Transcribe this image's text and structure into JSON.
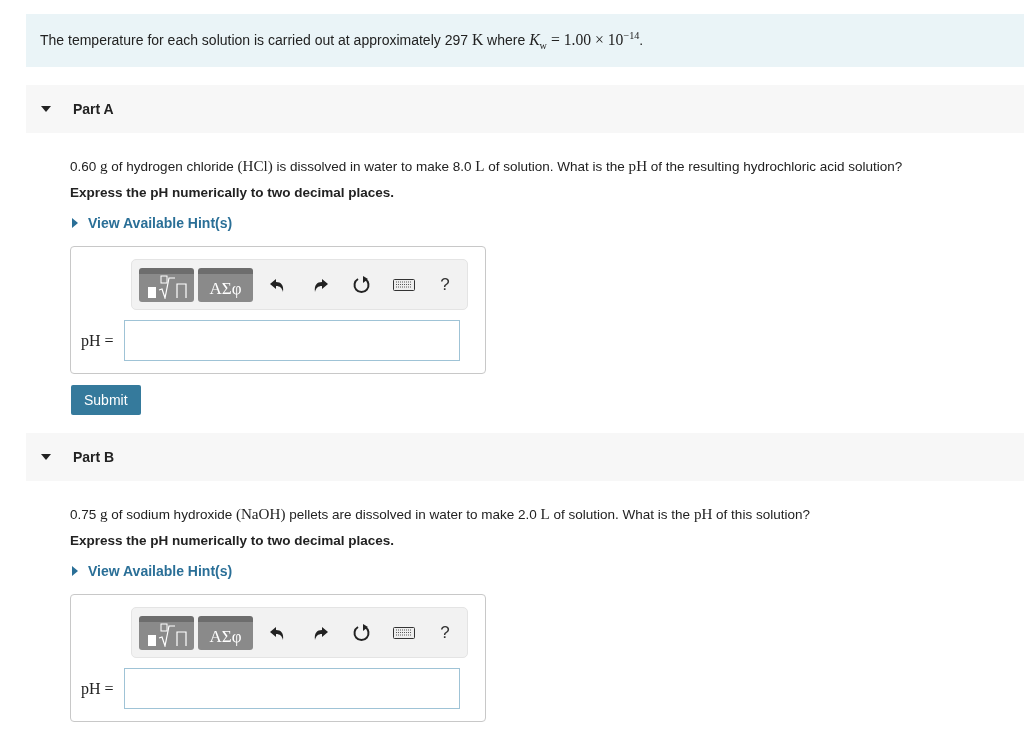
{
  "intro": [
    {
      "kind": "text",
      "text": "The temperature for each solution is carried out at approximately 297 "
    },
    {
      "kind": "math",
      "text": "K"
    },
    {
      "kind": "text",
      "text": " where "
    },
    {
      "kind": "math",
      "text": "*K*$_{w}$ = 1.00 × 10$^{−14}$"
    },
    {
      "kind": "text",
      "text": "."
    }
  ],
  "parts": [
    {
      "title": "Part A",
      "expanded": true,
      "question": [
        {
          "kind": "text",
          "text": "0.60 "
        },
        {
          "kind": "math",
          "text": "g"
        },
        {
          "kind": "text",
          "text": " of hydrogen chloride "
        },
        {
          "kind": "math",
          "text": "(HCl)"
        },
        {
          "kind": "text",
          "text": " is dissolved in water to make 8.0 "
        },
        {
          "kind": "math",
          "text": "L"
        },
        {
          "kind": "text",
          "text": "  of solution. What is the "
        },
        {
          "kind": "math",
          "text": "pH"
        },
        {
          "kind": "text",
          "text": " of the resulting hydrochloric acid solution?"
        }
      ],
      "instruction": "Express the pH numerically to two decimal places.",
      "hint": {
        "label": "View Available Hint(s)",
        "expanded": false
      },
      "answer": {
        "label": "pH =",
        "greek": "ΑΣφ",
        "help": "?"
      },
      "submit": "Submit"
    },
    {
      "title": "Part B",
      "expanded": true,
      "question": [
        {
          "kind": "text",
          "text": "0.75 "
        },
        {
          "kind": "math",
          "text": "g"
        },
        {
          "kind": "text",
          "text": " of sodium hydroxide "
        },
        {
          "kind": "math",
          "text": "(NaOH)"
        },
        {
          "kind": "text",
          "text": " pellets are dissolved in water to make 2.0 "
        },
        {
          "kind": "math",
          "text": "L"
        },
        {
          "kind": "text",
          "text": " of solution. What is the "
        },
        {
          "kind": "math",
          "text": "pH"
        },
        {
          "kind": "text",
          "text": " of this solution?"
        }
      ],
      "instruction": "Express the pH numerically to two decimal places.",
      "hint": {
        "label": "View Available Hint(s)",
        "expanded": false
      },
      "answer": {
        "label": "pH =",
        "greek": "ΑΣφ",
        "help": "?"
      }
    }
  ]
}
